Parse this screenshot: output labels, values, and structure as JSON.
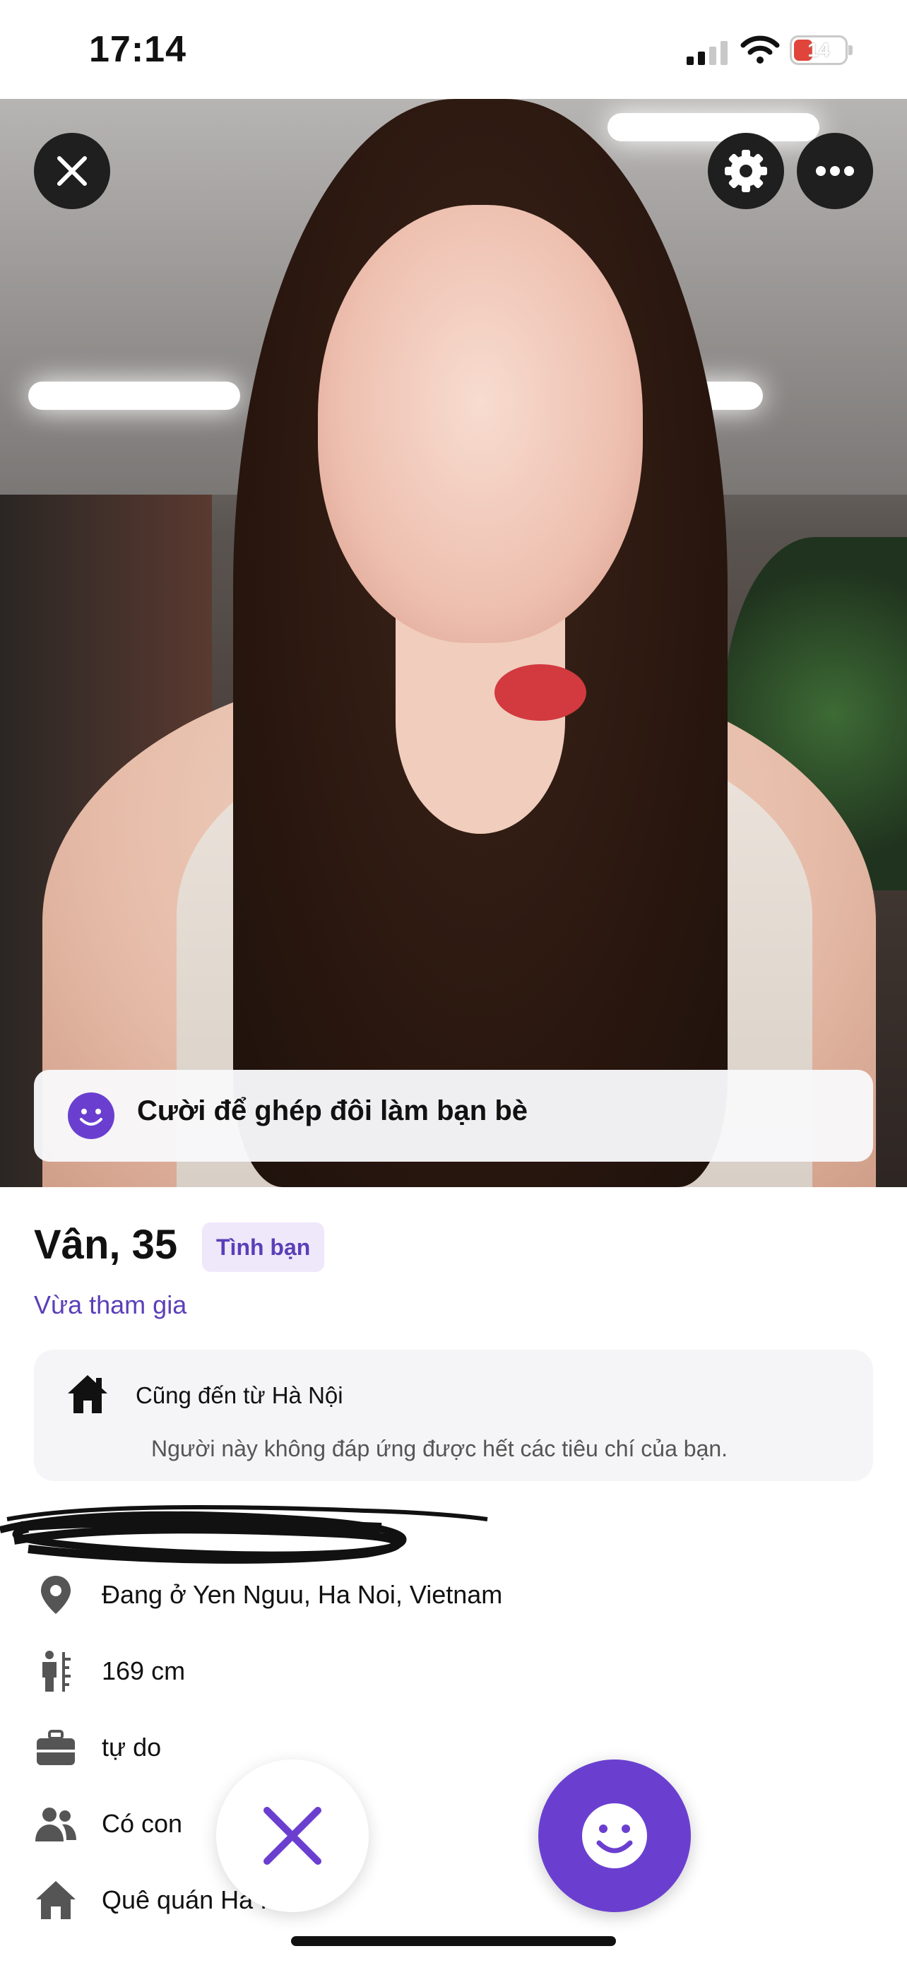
{
  "status_bar": {
    "time": "17:14",
    "battery": "14"
  },
  "photo_actions": {
    "close_icon": "close-icon",
    "settings_icon": "gear-icon",
    "more_icon": "more-icon"
  },
  "banner": {
    "text": "Cười để ghép đôi làm bạn bè",
    "icon": "smile-icon"
  },
  "profile": {
    "name_age": "Vân, 35",
    "badge": "Tình bạn",
    "joined": "Vừa tham gia"
  },
  "common_card": {
    "line1": "Cũng đến từ Hà Nội",
    "line2": "Người này không đáp ứng được hết các tiêu chí của bạn."
  },
  "details": [
    {
      "icon": "location-pin-icon",
      "text": "Đang ở Yen Nguu, Ha Noi, Vietnam"
    },
    {
      "icon": "height-icon",
      "text": "169 cm"
    },
    {
      "icon": "briefcase-icon",
      "text": "tự do"
    },
    {
      "icon": "people-icon",
      "text": "Có con"
    },
    {
      "icon": "home-icon",
      "text": "Quê quán Ha ..."
    }
  ],
  "actions": {
    "dislike_icon": "close-icon",
    "like_icon": "smile-icon"
  },
  "colors": {
    "accent": "#6a3fd0",
    "badge_bg": "#efe8fb",
    "card_bg": "#f5f5f7"
  }
}
